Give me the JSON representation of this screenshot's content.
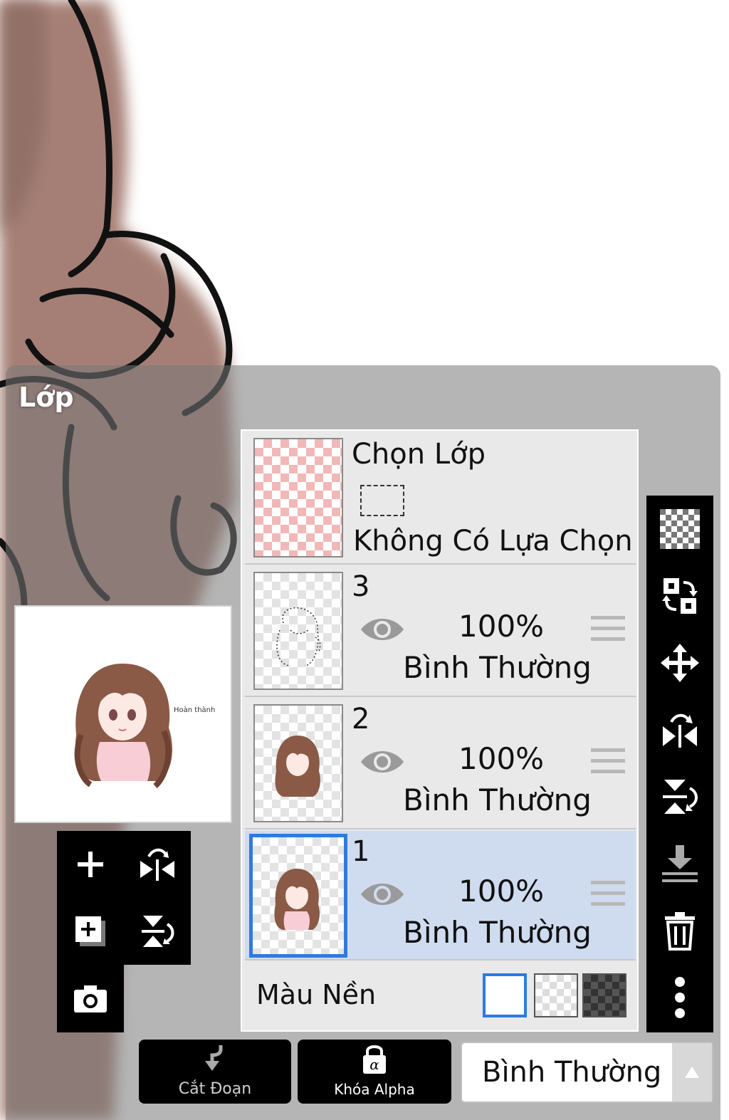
{
  "panel": {
    "title": "Lớp"
  },
  "selection_layer": {
    "name": "Chọn Lớp",
    "status": "Không Có Lựa Chọn"
  },
  "layers": [
    {
      "name": "3",
      "opacity": "100%",
      "blend": "Bình Thường",
      "visible": true,
      "selected": false
    },
    {
      "name": "2",
      "opacity": "100%",
      "blend": "Bình Thường",
      "visible": true,
      "selected": false
    },
    {
      "name": "1",
      "opacity": "100%",
      "blend": "Bình Thường",
      "visible": true,
      "selected": true
    }
  ],
  "background_color": {
    "label": "Màu Nền",
    "options": [
      "white",
      "transparent",
      "dark-checker"
    ],
    "selected": "white"
  },
  "right_toolbar": [
    "transparency-icon",
    "swap-layers-icon",
    "move-icon",
    "flip-horizontal-icon",
    "flip-vertical-icon",
    "merge-down-icon",
    "trash-icon",
    "more-icon"
  ],
  "left_toolbar": [
    "add-layer-icon",
    "flip-h-icon",
    "add-copy-layer-icon",
    "flip-v-icon",
    "camera-icon"
  ],
  "bottom": {
    "clipping_label": "Cắt Đoạn",
    "alpha_lock_label": "Khóa Alpha",
    "blend_mode": "Bình Thường"
  },
  "preview_text": "Hoàn thành",
  "colors": {
    "accent": "#2f7ae0",
    "selected_row": "#cfdcef",
    "toolbar": "#000000"
  }
}
